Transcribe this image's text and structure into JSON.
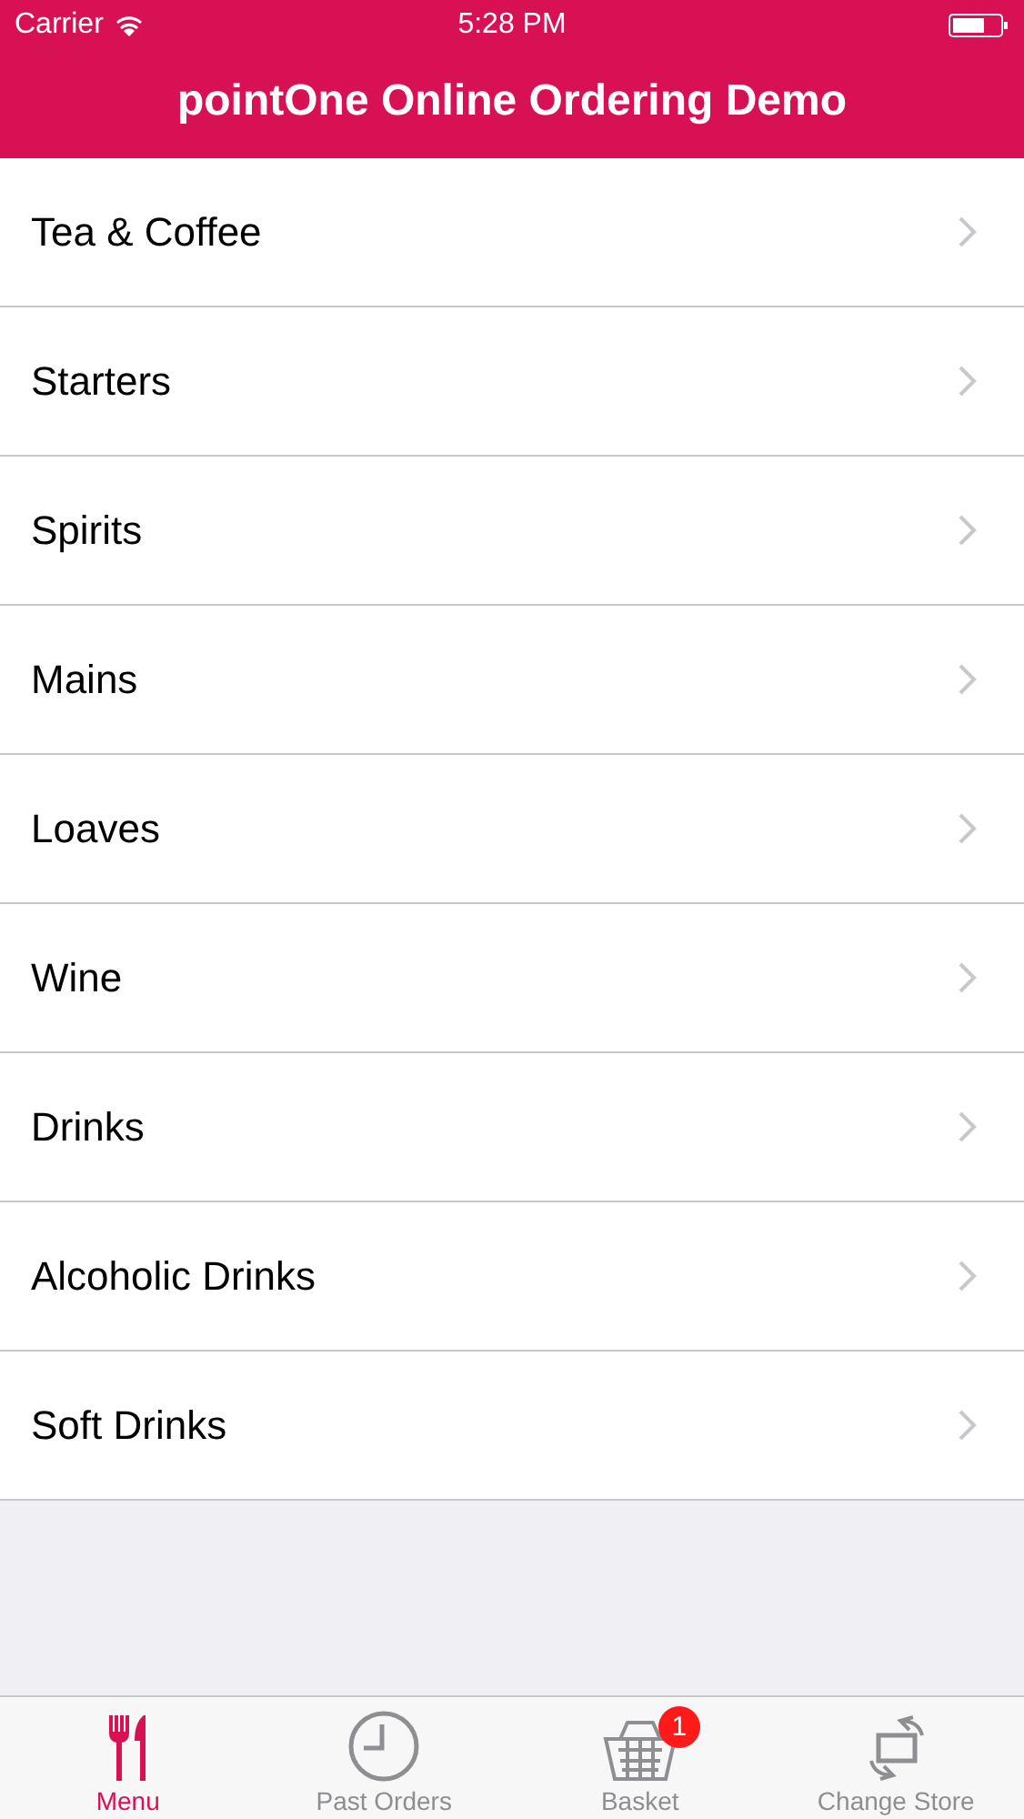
{
  "status_bar": {
    "carrier": "Carrier",
    "time": "5:28 PM"
  },
  "nav": {
    "title": "pointOne Online Ordering Demo"
  },
  "categories": [
    {
      "label": "Tea & Coffee"
    },
    {
      "label": "Starters"
    },
    {
      "label": "Spirits"
    },
    {
      "label": "Mains"
    },
    {
      "label": "Loaves"
    },
    {
      "label": "Wine"
    },
    {
      "label": "Drinks"
    },
    {
      "label": "Alcoholic Drinks"
    },
    {
      "label": "Soft Drinks"
    }
  ],
  "tab_bar": [
    {
      "kind": "menu",
      "label": "Menu",
      "selected": true
    },
    {
      "kind": "clock",
      "label": "Past Orders",
      "selected": false
    },
    {
      "kind": "basket",
      "label": "Basket",
      "selected": false,
      "badge": "1"
    },
    {
      "kind": "swap",
      "label": "Change Store",
      "selected": false
    }
  ]
}
